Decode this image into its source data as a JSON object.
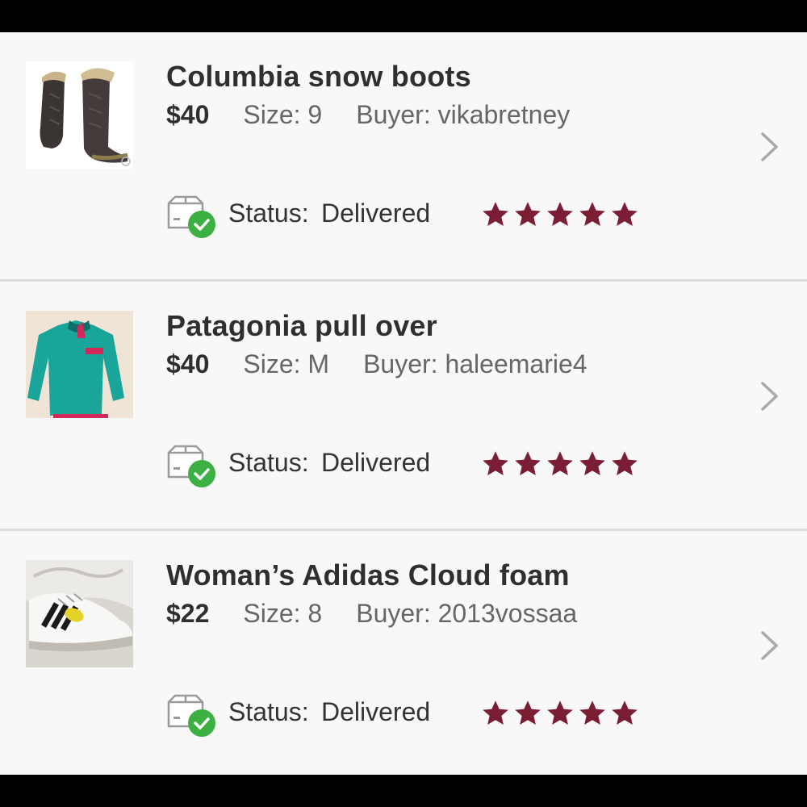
{
  "theme": {
    "star_color": "#7b1e33",
    "check_color": "#3cb043",
    "chevron_color": "#a9a9a9"
  },
  "orders": [
    {
      "title": "Columbia snow boots",
      "price": "$40",
      "size": "Size: 9",
      "buyer": "Buyer: vikabretney",
      "status_label": "Status:",
      "status_value": "Delivered",
      "rating": 5,
      "thumbnail_icon": "boots-photo"
    },
    {
      "title": "Patagonia pull over",
      "price": "$40",
      "size": "Size: M",
      "buyer": "Buyer: haleemarie4",
      "status_label": "Status:",
      "status_value": "Delivered",
      "rating": 5,
      "thumbnail_icon": "pullover-photo"
    },
    {
      "title": "Woman’s Adidas Cloud foam",
      "price": "$22",
      "size": "Size: 8",
      "buyer": "Buyer: 2013vossaa",
      "status_label": "Status:",
      "status_value": "Delivered",
      "rating": 5,
      "thumbnail_icon": "sneaker-photo"
    }
  ]
}
